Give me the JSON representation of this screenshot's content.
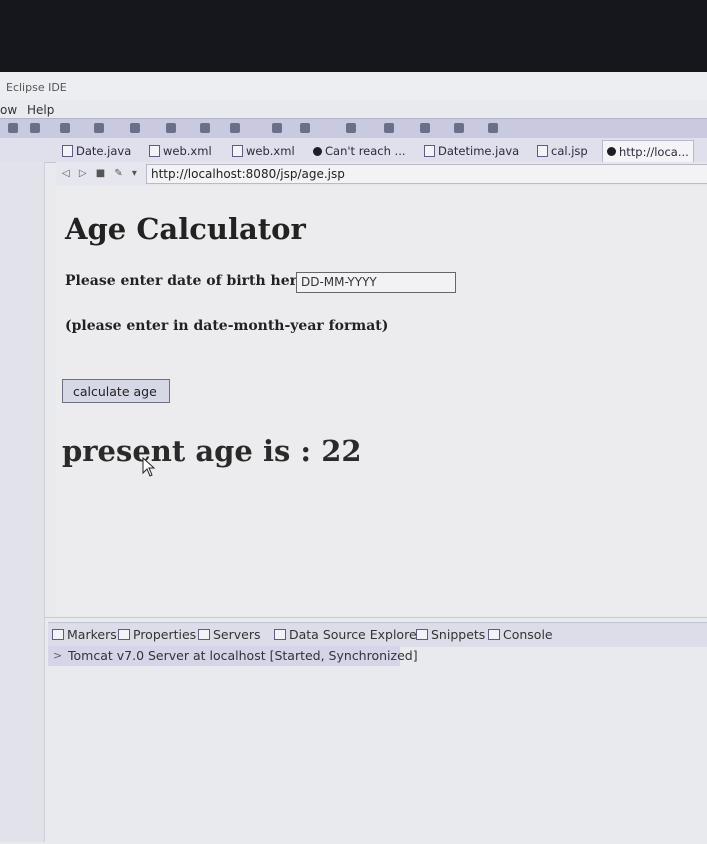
{
  "window": {
    "title": "Eclipse IDE"
  },
  "menu": {
    "items": [
      "ow",
      "Help"
    ]
  },
  "editor_tabs": [
    {
      "label": "Date.java",
      "icon": "java-file-icon",
      "active": false
    },
    {
      "label": "web.xml",
      "icon": "xml-file-icon",
      "active": false
    },
    {
      "label": "web.xml",
      "icon": "xml-file-icon",
      "active": false
    },
    {
      "label": "Can't reach ...",
      "icon": "browser-icon",
      "active": false
    },
    {
      "label": "Datetime.java",
      "icon": "java-file-icon",
      "active": false
    },
    {
      "label": "cal.jsp",
      "icon": "jsp-file-icon",
      "active": false
    },
    {
      "label": "http://loca...",
      "icon": "browser-icon",
      "active": true
    }
  ],
  "browser": {
    "url": "http://localhost:8080/jsp/age.jsp"
  },
  "page": {
    "title": "Age Calculator",
    "dob_label": "Please enter date of birth here:",
    "dob_value": "DD-MM-YYYY",
    "format_note": "(please enter in date-month-year format)",
    "button_label": "calculate age",
    "result": "present age is : 22"
  },
  "bottom_panel": {
    "tabs": [
      {
        "label": "Markers",
        "icon": "markers-icon"
      },
      {
        "label": "Properties",
        "icon": "properties-icon"
      },
      {
        "label": "Servers",
        "icon": "servers-icon"
      },
      {
        "label": "Data Source Explorer",
        "icon": "data-source-icon"
      },
      {
        "label": "Snippets",
        "icon": "snippets-icon"
      },
      {
        "label": "Console",
        "icon": "console-icon"
      }
    ],
    "server_entry": "Tomcat v7.0 Server at localhost  [Started, Synchronized]"
  }
}
